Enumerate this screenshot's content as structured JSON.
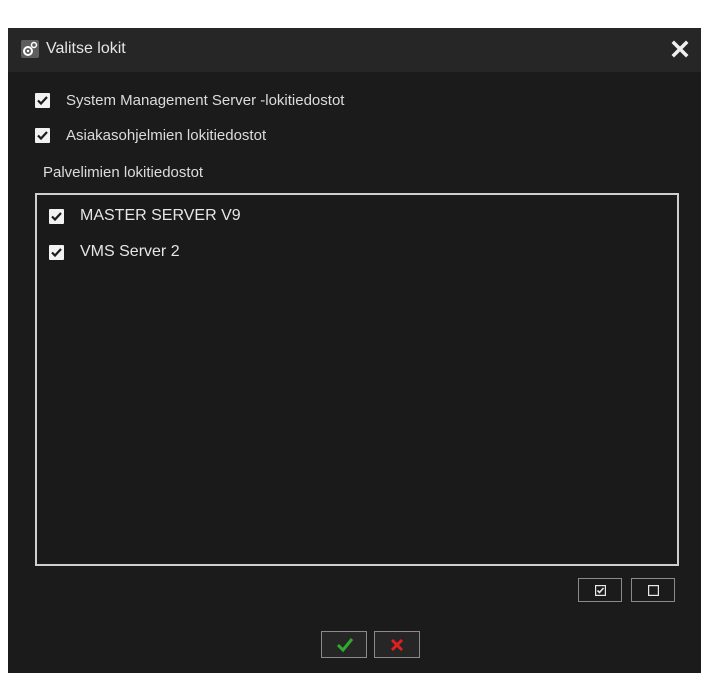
{
  "dialog": {
    "title": "Valitse lokit",
    "options": [
      {
        "label": "System Management Server -lokitiedostot",
        "checked": true
      },
      {
        "label": "Asiakasohjelmien lokitiedostot",
        "checked": true
      }
    ],
    "servers_label": "Palvelimien lokitiedostot",
    "servers": [
      {
        "label": "MASTER SERVER V9",
        "checked": true
      },
      {
        "label": "VMS Server 2",
        "checked": true
      }
    ],
    "buttons": {
      "select_all_icon": "checked-box-icon",
      "deselect_all_icon": "empty-box-icon",
      "ok_icon": "checkmark-icon",
      "cancel_icon": "x-icon"
    },
    "colors": {
      "background": "#1b1b1b",
      "titlebar": "#262626",
      "ok_green": "#2faa2f",
      "cancel_red": "#e02020"
    }
  }
}
